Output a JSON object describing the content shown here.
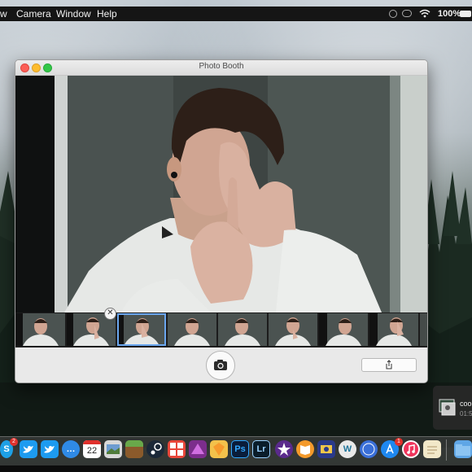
{
  "menubar": {
    "items": [
      "w",
      "Camera",
      "Window",
      "Help"
    ],
    "battery": "100%"
  },
  "window": {
    "title": "Photo Booth"
  },
  "strip": {
    "selected_index": 2
  },
  "dock": {
    "calendar_date": "22",
    "photoshop_label": "Ps",
    "lightroom_label": "Lr",
    "skype_badge": "2",
    "appstore_badge": "1"
  },
  "notification": {
    "title": "coo",
    "time": "01:5"
  }
}
